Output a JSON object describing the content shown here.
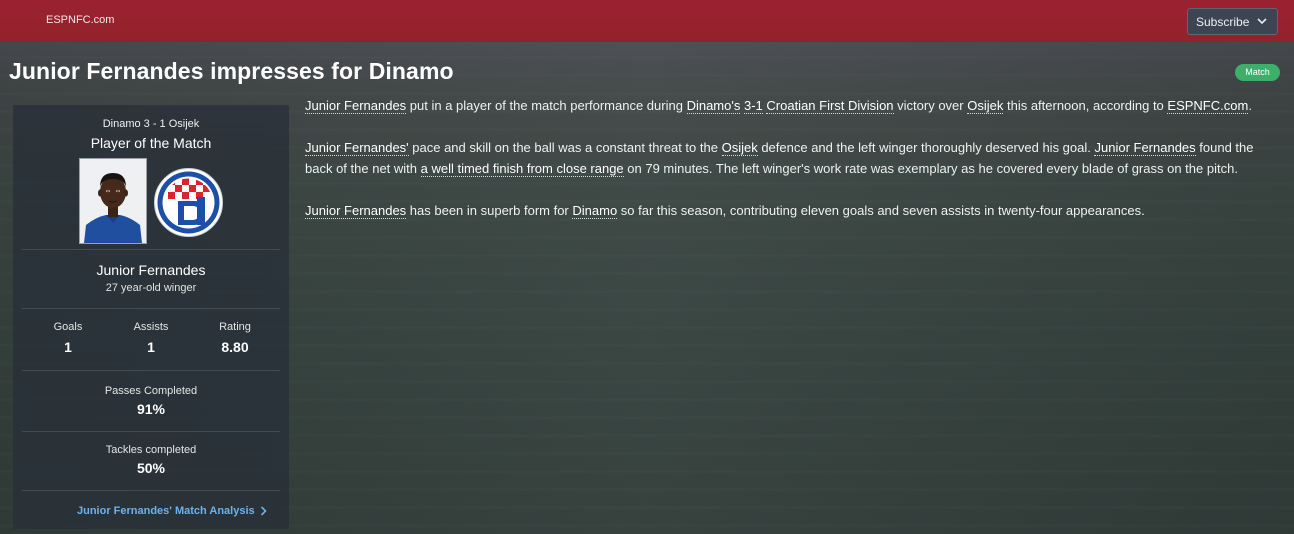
{
  "topbar": {
    "site_name": "ESPNFC.com",
    "subscribe_label": "Subscribe"
  },
  "headline": {
    "title": "Junior Fernandes impresses for Dinamo",
    "badge": "Match"
  },
  "panel": {
    "score": "Dinamo 3 - 1 Osijek",
    "award": "Player of the Match",
    "player_name": "Junior Fernandes",
    "player_desc": "27 year-old winger",
    "stats": [
      {
        "label": "Goals",
        "value": "1"
      },
      {
        "label": "Assists",
        "value": "1"
      },
      {
        "label": "Rating",
        "value": "8.80"
      }
    ],
    "passes": {
      "label": "Passes Completed",
      "value": "91%"
    },
    "tackles": {
      "label": "Tackles completed",
      "value": "50%"
    },
    "analysis_link": "Junior Fernandes' Match Analysis"
  },
  "article": {
    "p1": {
      "a": "Junior Fernandes",
      "b": " put in a player of the match performance during ",
      "c": "Dinamo's",
      "d": " ",
      "e": "3-1",
      "f": " ",
      "g": "Croatian First Division",
      "h": " victory over ",
      "i": "Osijek",
      "j": " this afternoon, according to ",
      "k": "ESPNFC.com",
      "l": "."
    },
    "p2": {
      "a": "Junior Fernandes'",
      "b": " pace and skill on the ball was a constant threat to the ",
      "c": "Osijek",
      "d": " defence and the left winger thoroughly deserved his goal. ",
      "e": "Junior Fernandes",
      "f": " found the back of the net with ",
      "g": "a well timed finish from close range",
      "h": " on 79 minutes. The left winger's work rate was exemplary as he covered every blade of grass on the pitch."
    },
    "p3": {
      "a": "Junior Fernandes",
      "b": " has been in superb form for ",
      "c": "Dinamo",
      "d": " so far this season, contributing eleven goals and seven assists in twenty-four appearances."
    }
  },
  "colors": {
    "top_bar": "#93222c",
    "badge": "#3fae6a",
    "link": "#6fb1ea",
    "panel": "#283038"
  },
  "icons": {
    "subscribe": "chevron-down-icon",
    "analysis": "chevron-right-icon",
    "club": "dinamo-zagreb-crest-icon"
  }
}
